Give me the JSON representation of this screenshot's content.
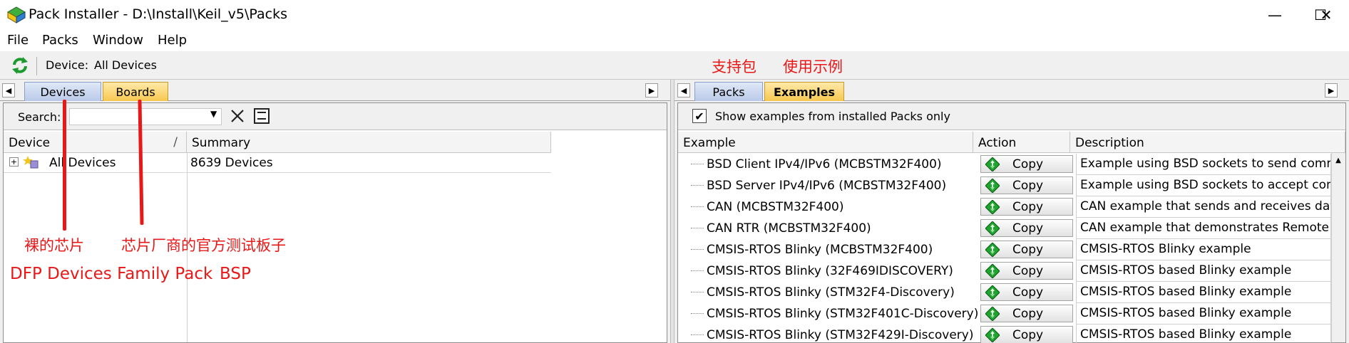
{
  "window": {
    "title": "Pack Installer - D:\\Install\\Keil_v5\\Packs",
    "minimize": "—",
    "maximize": "☐",
    "close": "✕"
  },
  "menu": [
    "File",
    "Packs",
    "Window",
    "Help"
  ],
  "toolbar": {
    "device_label": "Device:",
    "device_value": "All Devices"
  },
  "left": {
    "tabs": [
      "Devices",
      "Boards"
    ],
    "search_label": "Search:",
    "search_value": "",
    "columns": [
      "Device",
      "Summary"
    ],
    "sort_glyph": "/",
    "rows": [
      {
        "device": "All Devices",
        "summary": "8639 Devices"
      }
    ]
  },
  "right": {
    "tabs": [
      "Packs",
      "Examples"
    ],
    "checkbox_label": "Show examples from installed Packs only",
    "checkbox_checked": true,
    "columns": [
      "Example",
      "Action",
      "Description"
    ],
    "copy_label": "Copy",
    "rows": [
      {
        "example": "BSD Client IPv4/IPv6 (MCBSTM32F400)",
        "description": "Example using BSD sockets to send commar"
      },
      {
        "example": "BSD Server IPv4/IPv6 (MCBSTM32F400)",
        "description": "Example using BSD sockets to accept comm"
      },
      {
        "example": "CAN (MCBSTM32F400)",
        "description": "CAN example that sends and receives data m"
      },
      {
        "example": "CAN RTR (MCBSTM32F400)",
        "description": "CAN example that demonstrates Remote Tra"
      },
      {
        "example": "CMSIS-RTOS Blinky (MCBSTM32F400)",
        "description": "CMSIS-RTOS Blinky example"
      },
      {
        "example": "CMSIS-RTOS Blinky (32F469IDISCOVERY)",
        "description": "CMSIS-RTOS based Blinky example"
      },
      {
        "example": "CMSIS-RTOS Blinky (STM32F4-Discovery)",
        "description": "CMSIS-RTOS based Blinky example"
      },
      {
        "example": "CMSIS-RTOS Blinky (STM32F401C-Discovery)",
        "description": "CMSIS-RTOS based Blinky example"
      },
      {
        "example": "CMSIS-RTOS Blinky (STM32F429I-Discovery)",
        "description": "CMSIS-RTOS based Blinky example"
      }
    ]
  },
  "annotations": {
    "packs": "支持包",
    "examples": "使用示例",
    "bare_chip": "裸的芯片",
    "vendor_board": "芯片厂商的官方测试板子",
    "dfp": "DFP Devices Family Pack",
    "bsp": "BSP"
  },
  "colors": {
    "annotation": "#e81818",
    "tab_blue": "#c8d6ee",
    "tab_yellow": "#f7c850"
  }
}
